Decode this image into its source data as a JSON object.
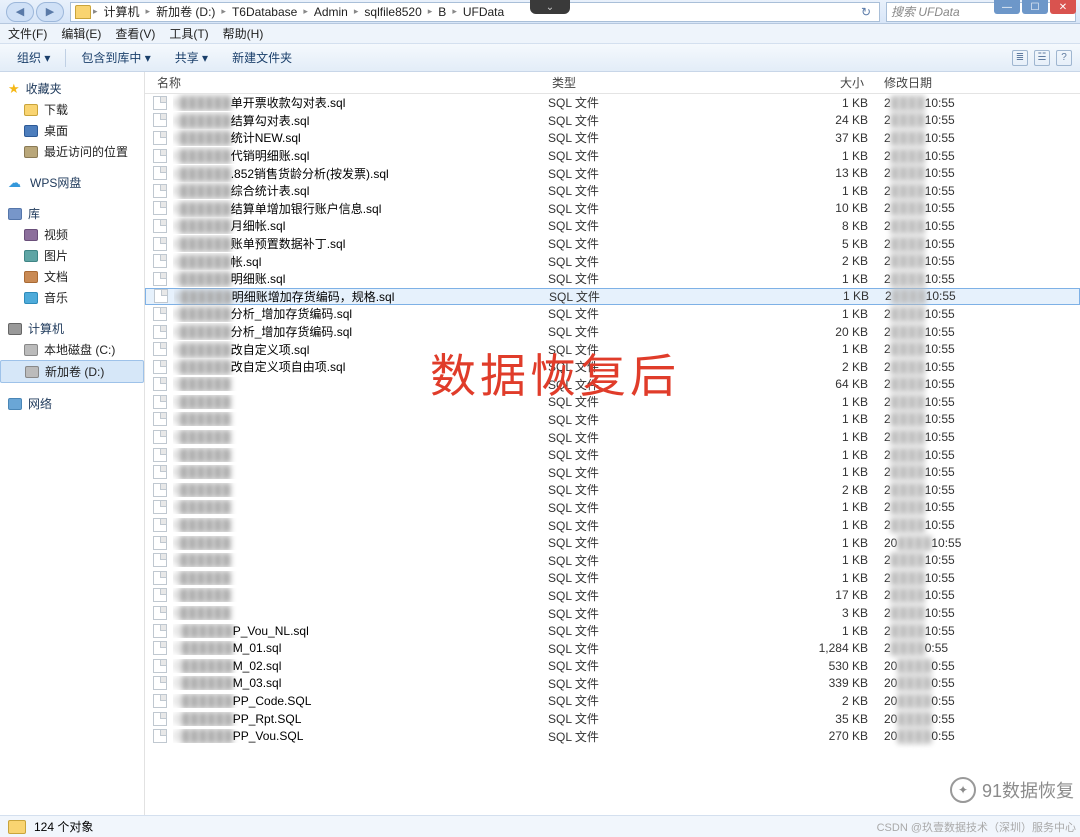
{
  "window": {
    "dropdown_glyph": "⌄",
    "min": "—",
    "max": "☐",
    "close": "✕"
  },
  "breadcrumb": {
    "sep": "▸",
    "items": [
      "计算机",
      "新加卷 (D:)",
      "T6Database",
      "Admin",
      "sqlfile8520",
      "B",
      "UFData"
    ],
    "refresh": "↻"
  },
  "search": {
    "placeholder": "搜索 UFData"
  },
  "menu": {
    "file": "文件(F)",
    "edit": "编辑(E)",
    "view": "查看(V)",
    "tools": "工具(T)",
    "help": "帮助(H)"
  },
  "toolbar": {
    "organize": "组织 ▾",
    "include": "包含到库中 ▾",
    "share": "共享 ▾",
    "newfolder": "新建文件夹",
    "viewmode": "≣",
    "details": "☱",
    "help": "?"
  },
  "sidebar": {
    "favorites": {
      "label": "收藏夹",
      "downloads": "下载",
      "desktop": "桌面",
      "recent": "最近访问的位置"
    },
    "wps": {
      "label": "WPS网盘"
    },
    "libraries": {
      "label": "库",
      "videos": "视频",
      "pictures": "图片",
      "documents": "文档",
      "music": "音乐"
    },
    "computer": {
      "label": "计算机",
      "diskC": "本地磁盘 (C:)",
      "diskD": "新加卷 (D:)"
    },
    "network": {
      "label": "网络"
    }
  },
  "columns": {
    "name": "名称",
    "type": "类型",
    "size": "大小",
    "date": "修改日期"
  },
  "filetype": "SQL 文件",
  "files": [
    {
      "p": "8",
      "n": "单开票收款勾对表.sql",
      "s": "1 KB",
      "d": "2",
      "t": "10:55"
    },
    {
      "p": "8",
      "n": "结算勾对表.sql",
      "s": "24 KB",
      "d": "2",
      "t": "10:55"
    },
    {
      "p": "8",
      "n": "统计NEW.sql",
      "s": "37 KB",
      "d": "2",
      "t": "10:55"
    },
    {
      "p": "8",
      "n": "代销明细账.sql",
      "s": "1 KB",
      "d": "2",
      "t": "10:55"
    },
    {
      "p": "8",
      "n": ".852销售货龄分析(按发票).sql",
      "s": "13 KB",
      "d": "2",
      "t": "10:55"
    },
    {
      "p": "8",
      "n": "综合统计表.sql",
      "s": "1 KB",
      "d": "2",
      "t": "10:55"
    },
    {
      "p": "8",
      "n": "结算单增加银行账户信息.sql",
      "s": "10 KB",
      "d": "2",
      "t": "10:55"
    },
    {
      "p": "8",
      "n": "月细帐.sql",
      "s": "8 KB",
      "d": "2",
      "t": "10:55"
    },
    {
      "p": "8",
      "n": "账单预置数据补丁.sql",
      "s": "5 KB",
      "d": "2",
      "t": "10:55"
    },
    {
      "p": "8",
      "n": "帐.sql",
      "s": "2 KB",
      "d": "2",
      "t": "10:55"
    },
    {
      "p": "8",
      "n": "明细账.sql",
      "s": "1 KB",
      "d": "2",
      "t": "10:55"
    },
    {
      "p": "8",
      "n": "明细账增加存货编码，规格.sql",
      "s": "1 KB",
      "d": "2",
      "t": "10:55",
      "sel": true
    },
    {
      "p": "8",
      "n": "分析_增加存货编码.sql",
      "s": "1 KB",
      "d": "2",
      "t": "10:55"
    },
    {
      "p": "8",
      "n": "分析_增加存货编码.sql",
      "s": "20 KB",
      "d": "2",
      "t": "10:55"
    },
    {
      "p": "8",
      "n": "改自定义项.sql",
      "s": "1 KB",
      "d": "2",
      "t": "10:55"
    },
    {
      "p": "8",
      "n": "改自定义项自由项.sql",
      "s": "2 KB",
      "d": "2",
      "t": "10:55"
    },
    {
      "p": "5",
      "n": "",
      "s": "64 KB",
      "d": "2",
      "t": "10:55"
    },
    {
      "p": "5",
      "n": "",
      "s": "1 KB",
      "d": "2",
      "t": "10:55"
    },
    {
      "p": "6",
      "n": "",
      "s": "1 KB",
      "d": "2",
      "t": "10:55"
    },
    {
      "p": "6",
      "n": "",
      "s": "1 KB",
      "d": "2",
      "t": "10:55"
    },
    {
      "p": "6",
      "n": "",
      "s": "1 KB",
      "d": "2",
      "t": "10:55"
    },
    {
      "p": "6",
      "n": "",
      "s": "1 KB",
      "d": "2",
      "t": "10:55"
    },
    {
      "p": "6",
      "n": "",
      "s": "2 KB",
      "d": "2",
      "t": "10:55"
    },
    {
      "p": "6",
      "n": "",
      "s": "1 KB",
      "d": "2",
      "t": "10:55"
    },
    {
      "p": "6",
      "n": "",
      "s": "1 KB",
      "d": "2",
      "t": "10:55"
    },
    {
      "p": "6",
      "n": "",
      "s": "1 KB",
      "d": "20",
      "t": "10:55"
    },
    {
      "p": "6",
      "n": "",
      "s": "1 KB",
      "d": "2",
      "t": "10:55"
    },
    {
      "p": "6",
      "n": "",
      "s": "1 KB",
      "d": "2",
      "t": "10:55"
    },
    {
      "p": "6",
      "n": "",
      "s": "17 KB",
      "d": "2",
      "t": "10:55"
    },
    {
      "p": "6",
      "n": "",
      "s": "3 KB",
      "d": "2",
      "t": "10:55"
    },
    {
      "p": "D",
      "n": "P_Vou_NL.sql",
      "s": "1 KB",
      "d": "2",
      "t": "10:55"
    },
    {
      "p": "D",
      "n": "M_01.sql",
      "s": "1,284 KB",
      "d": "2",
      "t": "0:55"
    },
    {
      "p": "D",
      "n": "M_02.sql",
      "s": "530 KB",
      "d": "20",
      "t": "0:55"
    },
    {
      "p": "D",
      "n": "M_03.sql",
      "s": "339 KB",
      "d": "20",
      "t": "0:55"
    },
    {
      "p": "D",
      "n": "PP_Code.SQL",
      "s": "2 KB",
      "d": "20",
      "t": "0:55"
    },
    {
      "p": "D",
      "n": "PP_Rpt.SQL",
      "s": "35 KB",
      "d": "20",
      "t": "0:55"
    },
    {
      "p": "D",
      "n": "PP_Vou.SQL",
      "s": "270 KB",
      "d": "20",
      "t": "0:55"
    }
  ],
  "status": {
    "count": "124 个对象"
  },
  "overlay": "数据恢复后",
  "watermark": {
    "chat": "91数据恢复",
    "csdn": "CSDN @玖壹数据技术（深圳）服务中心"
  }
}
